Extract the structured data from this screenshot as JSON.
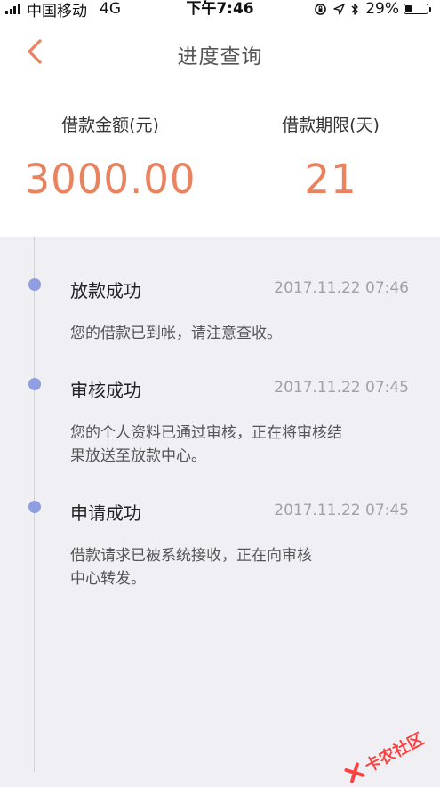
{
  "status_bar": {
    "carrier": "中国移动",
    "network": "4G",
    "time": "下午7:46",
    "battery": "29%"
  },
  "header": {
    "title": "进度查询",
    "back_icon": "chevron-left-icon"
  },
  "summary": {
    "amount_label": "借款金额(元)",
    "amount_value": "3000.00",
    "term_label": "借款期限(天)",
    "term_value": "21"
  },
  "timeline": [
    {
      "title": "放款成功",
      "time": "2017.11.22 07:46",
      "desc_lines": [
        "您的借款已到帐，请注意查收。"
      ]
    },
    {
      "title": "审核成功",
      "time": "2017.11.22 07:45",
      "desc_lines": [
        "您的个人资料已通过审核，正在将审核结",
        "果放送至放款中心。"
      ]
    },
    {
      "title": "申请成功",
      "time": "2017.11.22 07:45",
      "desc_lines": [
        "借款请求已被系统接收，正在向审核",
        "中心转发。"
      ]
    }
  ],
  "watermark": {
    "text": "卡农社区"
  },
  "colors": {
    "accent": "#e8825f",
    "dot": "#8e9ee0",
    "background": "#efeff4"
  }
}
